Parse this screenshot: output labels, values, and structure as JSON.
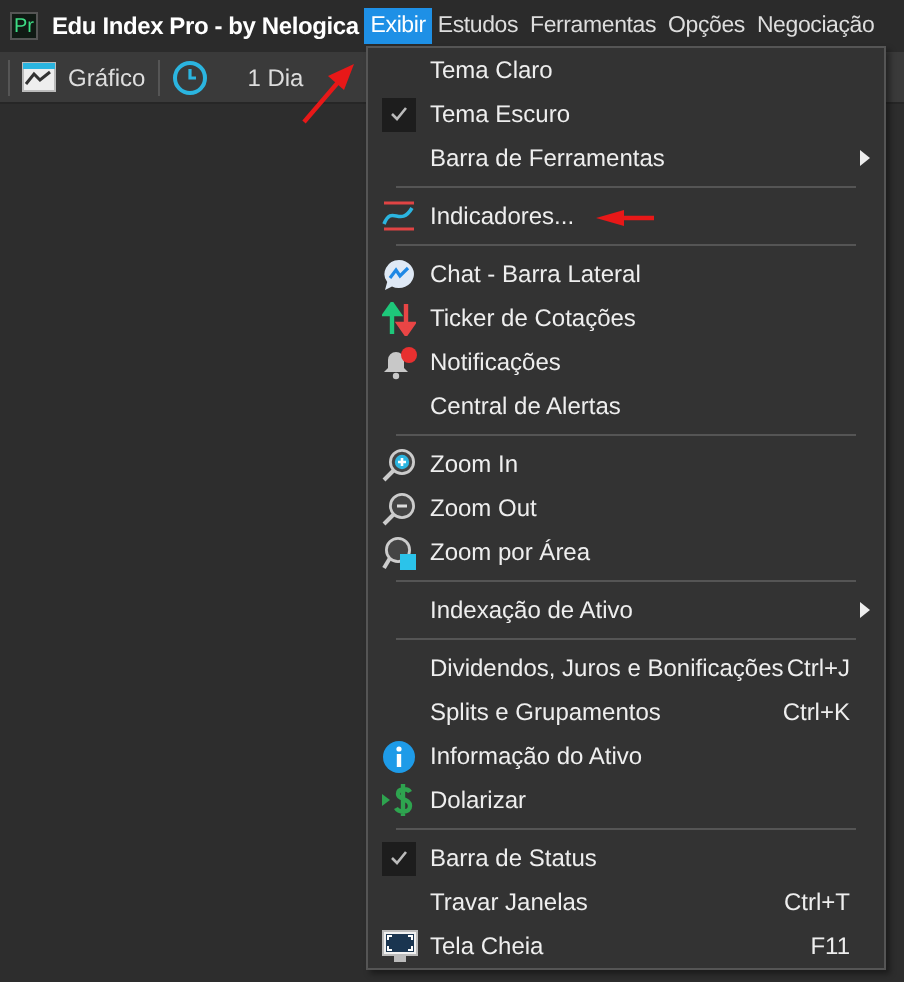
{
  "app": {
    "logo": "Pr",
    "title": "Edu Index Pro - by Nelogica"
  },
  "menubar": [
    {
      "label": "Exibir",
      "selected": true
    },
    {
      "label": "Estudos",
      "selected": false
    },
    {
      "label": "Ferramentas",
      "selected": false
    },
    {
      "label": "Opções",
      "selected": false
    },
    {
      "label": "Negociação",
      "selected": false
    }
  ],
  "toolbar": {
    "chart_button": "Gráfico",
    "period": "1 Dia"
  },
  "menu": [
    {
      "kind": "item",
      "label": "Tema Claro",
      "checked": false
    },
    {
      "kind": "item",
      "label": "Tema Escuro",
      "checked": true
    },
    {
      "kind": "submenu",
      "label": "Barra de Ferramentas",
      "checked": false
    },
    {
      "kind": "separator"
    },
    {
      "kind": "item",
      "label": "Indicadores...",
      "checked": false
    },
    {
      "kind": "separator"
    },
    {
      "kind": "item",
      "label": "Chat - Barra Lateral",
      "checked": false
    },
    {
      "kind": "item",
      "label": "Ticker de Cotações",
      "checked": false
    },
    {
      "kind": "item",
      "label": "Notificações",
      "checked": false
    },
    {
      "kind": "item",
      "label": "Central de Alertas",
      "checked": false
    },
    {
      "kind": "separator"
    },
    {
      "kind": "item",
      "label": "Zoom In",
      "checked": false
    },
    {
      "kind": "item",
      "label": "Zoom Out",
      "checked": false
    },
    {
      "kind": "item",
      "label": "Zoom por Área",
      "checked": false
    },
    {
      "kind": "separator"
    },
    {
      "kind": "submenu",
      "label": "Indexação de Ativo",
      "checked": false
    },
    {
      "kind": "separator"
    },
    {
      "kind": "item",
      "label": "Dividendos, Juros e Bonificações",
      "checked": false,
      "shortcut": "Ctrl+J"
    },
    {
      "kind": "item",
      "label": "Splits e Grupamentos",
      "checked": false,
      "shortcut": "Ctrl+K"
    },
    {
      "kind": "item",
      "label": "Informação do Ativo",
      "checked": false
    },
    {
      "kind": "item",
      "label": "Dolarizar",
      "checked": false
    },
    {
      "kind": "separator"
    },
    {
      "kind": "item",
      "label": "Barra de Status",
      "checked": true
    },
    {
      "kind": "item",
      "label": "Travar Janelas",
      "checked": false,
      "shortcut": "Ctrl+T"
    },
    {
      "kind": "item",
      "label": "Tela Cheia",
      "checked": false,
      "shortcut": "F11"
    }
  ]
}
